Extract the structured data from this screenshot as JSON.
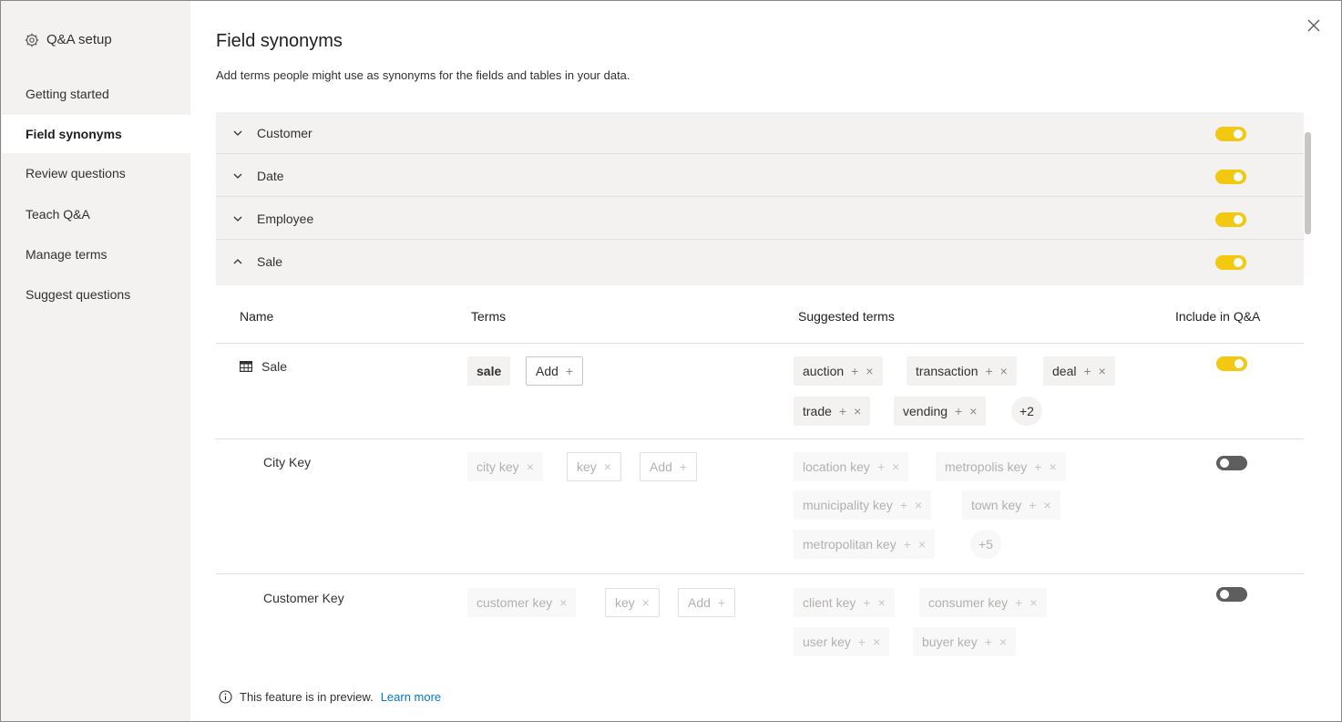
{
  "sidebar": {
    "header": "Q&A setup",
    "items": [
      {
        "label": "Getting started"
      },
      {
        "label": "Field synonyms"
      },
      {
        "label": "Review questions"
      },
      {
        "label": "Teach Q&A"
      },
      {
        "label": "Manage terms"
      },
      {
        "label": "Suggest questions"
      }
    ],
    "active_item": "Field synonyms"
  },
  "main": {
    "title": "Field synonyms",
    "subtitle": "Add terms people might use as synonyms for the fields and tables in your data.",
    "tables": [
      {
        "name": "Customer",
        "expanded": false,
        "included": true
      },
      {
        "name": "Date",
        "expanded": false,
        "included": true
      },
      {
        "name": "Employee",
        "expanded": false,
        "included": true
      },
      {
        "name": "Sale",
        "expanded": true,
        "included": true
      }
    ],
    "columns": {
      "name": "Name",
      "terms": "Terms",
      "suggested": "Suggested terms",
      "include": "Include in Q&A"
    },
    "rows": [
      {
        "name": "Sale",
        "terms": [
          "sale"
        ],
        "add_label": "Add",
        "suggested": [
          "auction",
          "transaction",
          "deal",
          "trade",
          "vending"
        ],
        "more": "+2",
        "included": true
      },
      {
        "name": "City Key",
        "terms": [
          "city key",
          "key"
        ],
        "add_label": "Add",
        "suggested": [
          "location key",
          "metropolis key",
          "municipality key",
          "town key",
          "metropolitan key"
        ],
        "more": "+5",
        "included": false
      },
      {
        "name": "Customer Key",
        "terms": [
          "customer key",
          "key"
        ],
        "add_label": "Add",
        "suggested": [
          "client key",
          "consumer key",
          "user key",
          "buyer key"
        ],
        "included": false
      }
    ],
    "footer": {
      "text": "This feature is in preview.",
      "link": "Learn more"
    }
  },
  "colors": {
    "toggle_on": "#f2c811",
    "toggle_off": "#605e5c",
    "link": "#0078d4",
    "sidebar_bg": "#f3f2f1"
  }
}
